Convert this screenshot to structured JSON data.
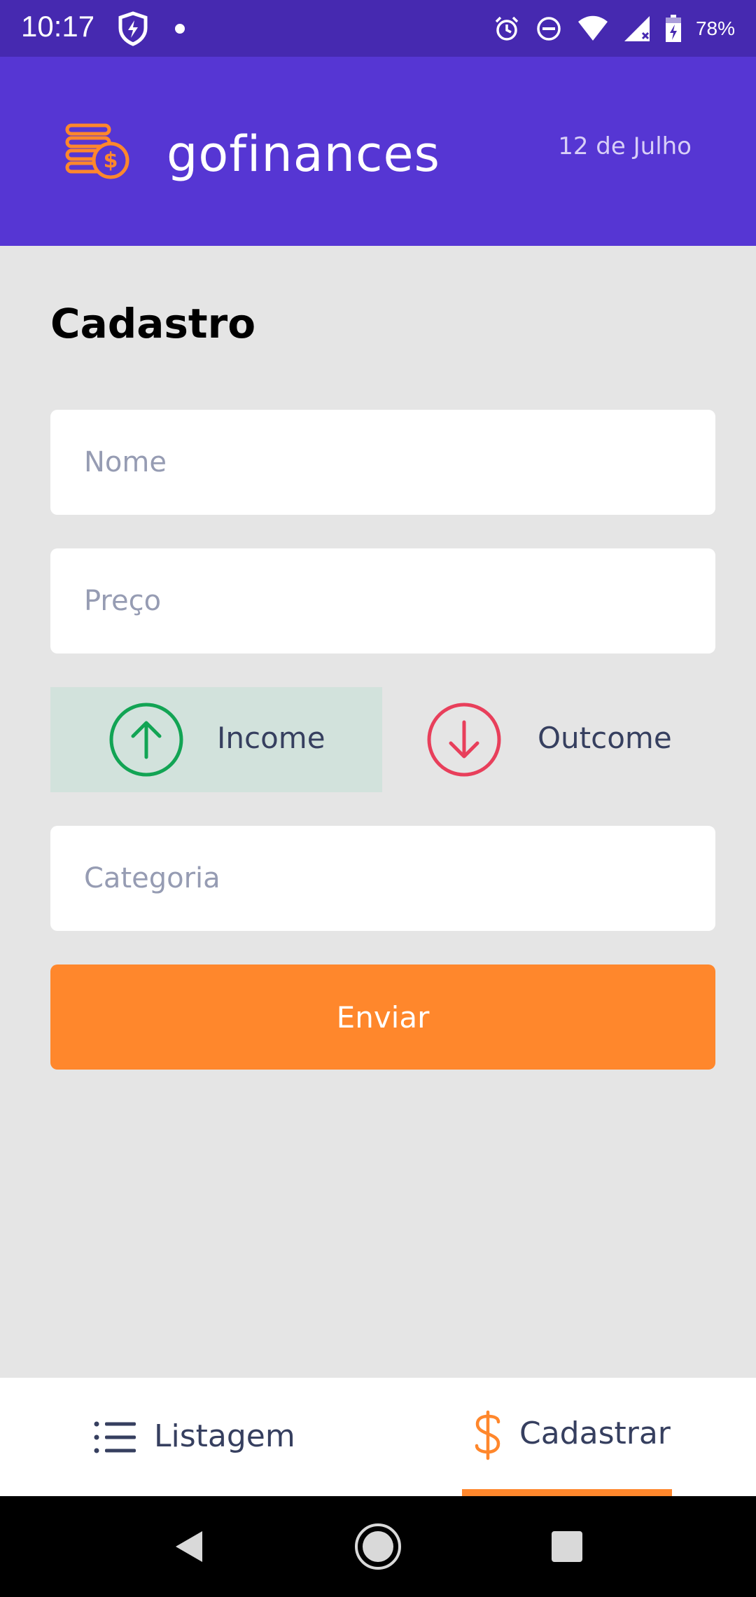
{
  "status_bar": {
    "time": "10:17",
    "battery": "78%",
    "icons": [
      "shield-bolt-icon",
      "notification-dot",
      "alarm-icon",
      "do-not-disturb-icon",
      "wifi-icon",
      "signal-icon",
      "battery-charging-icon"
    ]
  },
  "header": {
    "app_name": "gofinances",
    "date": "12 de Julho",
    "logo_icon": "coins-dollar-icon"
  },
  "form": {
    "title": "Cadastro",
    "name_placeholder": "Nome",
    "name_value": "",
    "price_placeholder": "Preço",
    "price_value": "",
    "income_label": "Income",
    "outcome_label": "Outcome",
    "selected_type": "income",
    "category_placeholder": "Categoria",
    "category_value": "",
    "submit_label": "Enviar"
  },
  "tabs": [
    {
      "label": "Listagem",
      "icon": "list-icon",
      "active": false
    },
    {
      "label": "Cadastrar",
      "icon": "dollar-sign-icon",
      "active": true
    }
  ],
  "colors": {
    "status_bar": "#4629b0",
    "header": "#5636d3",
    "background": "#e5e5e5",
    "accent": "#ff872c",
    "income": "#12a454",
    "outcome": "#e83f5b",
    "income_selected_bg": "#d2e2dc",
    "text": "#363f5f",
    "placeholder": "#969cb3"
  },
  "nav_bar": {
    "buttons": [
      "back-icon",
      "home-icon",
      "recents-icon"
    ]
  }
}
